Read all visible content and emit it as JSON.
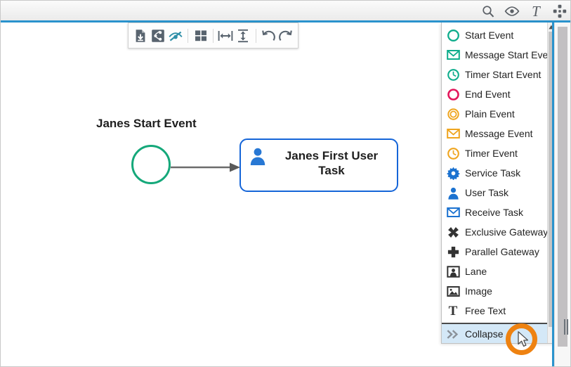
{
  "header": {
    "icons": [
      {
        "name": "search-icon",
        "label": "Search"
      },
      {
        "name": "eye-icon",
        "label": "Show/Hide"
      },
      {
        "name": "text-icon",
        "label": "Text"
      },
      {
        "name": "move-icon",
        "label": "Move"
      }
    ]
  },
  "toolbar": {
    "buttons": [
      {
        "name": "download-icon",
        "label": "Download"
      },
      {
        "name": "share-icon",
        "label": "Share"
      },
      {
        "name": "eye-slash-icon",
        "label": "Hide"
      },
      {
        "name": "grid-icon",
        "label": "Grid"
      },
      {
        "name": "fit-horizontal-icon",
        "label": "Fit Width"
      },
      {
        "name": "fit-vertical-icon",
        "label": "Fit Height"
      },
      {
        "name": "undo-icon",
        "label": "Undo"
      },
      {
        "name": "redo-icon",
        "label": "Redo"
      }
    ]
  },
  "diagram": {
    "start_event_label": "Janes Start Event",
    "user_task_label": "Janes First User Task",
    "start_event_color": "#15a87a",
    "user_task_color": "#1565d8",
    "connector_color": "#6b6b6b"
  },
  "palette": {
    "items": [
      {
        "label": "Start Event",
        "icon": "circle-outline-icon",
        "color": "#0ead8c",
        "selected": false,
        "separator": false
      },
      {
        "label": "Message Start Event",
        "icon": "envelope-icon",
        "color": "#0ead8c",
        "selected": false,
        "separator": false
      },
      {
        "label": "Timer Start Event",
        "icon": "clock-icon",
        "color": "#0ead8c",
        "selected": false,
        "separator": false
      },
      {
        "label": "End Event",
        "icon": "circle-outline-icon",
        "color": "#e3165b",
        "selected": false,
        "separator": false
      },
      {
        "label": "Plain Event",
        "icon": "double-circle-icon",
        "color": "#efa51f",
        "selected": false,
        "separator": false
      },
      {
        "label": "Message Event",
        "icon": "envelope-icon",
        "color": "#efa51f",
        "selected": false,
        "separator": false
      },
      {
        "label": "Timer Event",
        "icon": "clock-icon",
        "color": "#efa51f",
        "selected": false,
        "separator": false
      },
      {
        "label": "Service Task",
        "icon": "gear-icon",
        "color": "#1b72d0",
        "selected": false,
        "separator": false
      },
      {
        "label": "User Task",
        "icon": "person-icon",
        "color": "#1b72d0",
        "selected": false,
        "separator": false
      },
      {
        "label": "Receive Task",
        "icon": "envelope-icon",
        "color": "#1b72d0",
        "selected": false,
        "separator": false
      },
      {
        "label": "Exclusive Gateway",
        "icon": "x-burst-icon",
        "color": "#333333",
        "selected": false,
        "separator": false
      },
      {
        "label": "Parallel Gateway",
        "icon": "plus-burst-icon",
        "color": "#333333",
        "selected": false,
        "separator": false
      },
      {
        "label": "Lane",
        "icon": "lane-icon",
        "color": "#333333",
        "selected": false,
        "separator": false
      },
      {
        "label": "Image",
        "icon": "image-icon",
        "color": "#333333",
        "selected": false,
        "separator": false
      },
      {
        "label": "Free Text",
        "icon": "free-text-icon",
        "color": "#333333",
        "selected": false,
        "separator": false
      },
      {
        "label": "Collapse",
        "icon": "double-chevron-right-icon",
        "color": "#8a9199",
        "selected": true,
        "separator": true
      }
    ]
  },
  "colors": {
    "accent_blue": "#2a93cd",
    "selection_blue": "#d4e8f7",
    "highlight_orange": "#ee8211"
  }
}
